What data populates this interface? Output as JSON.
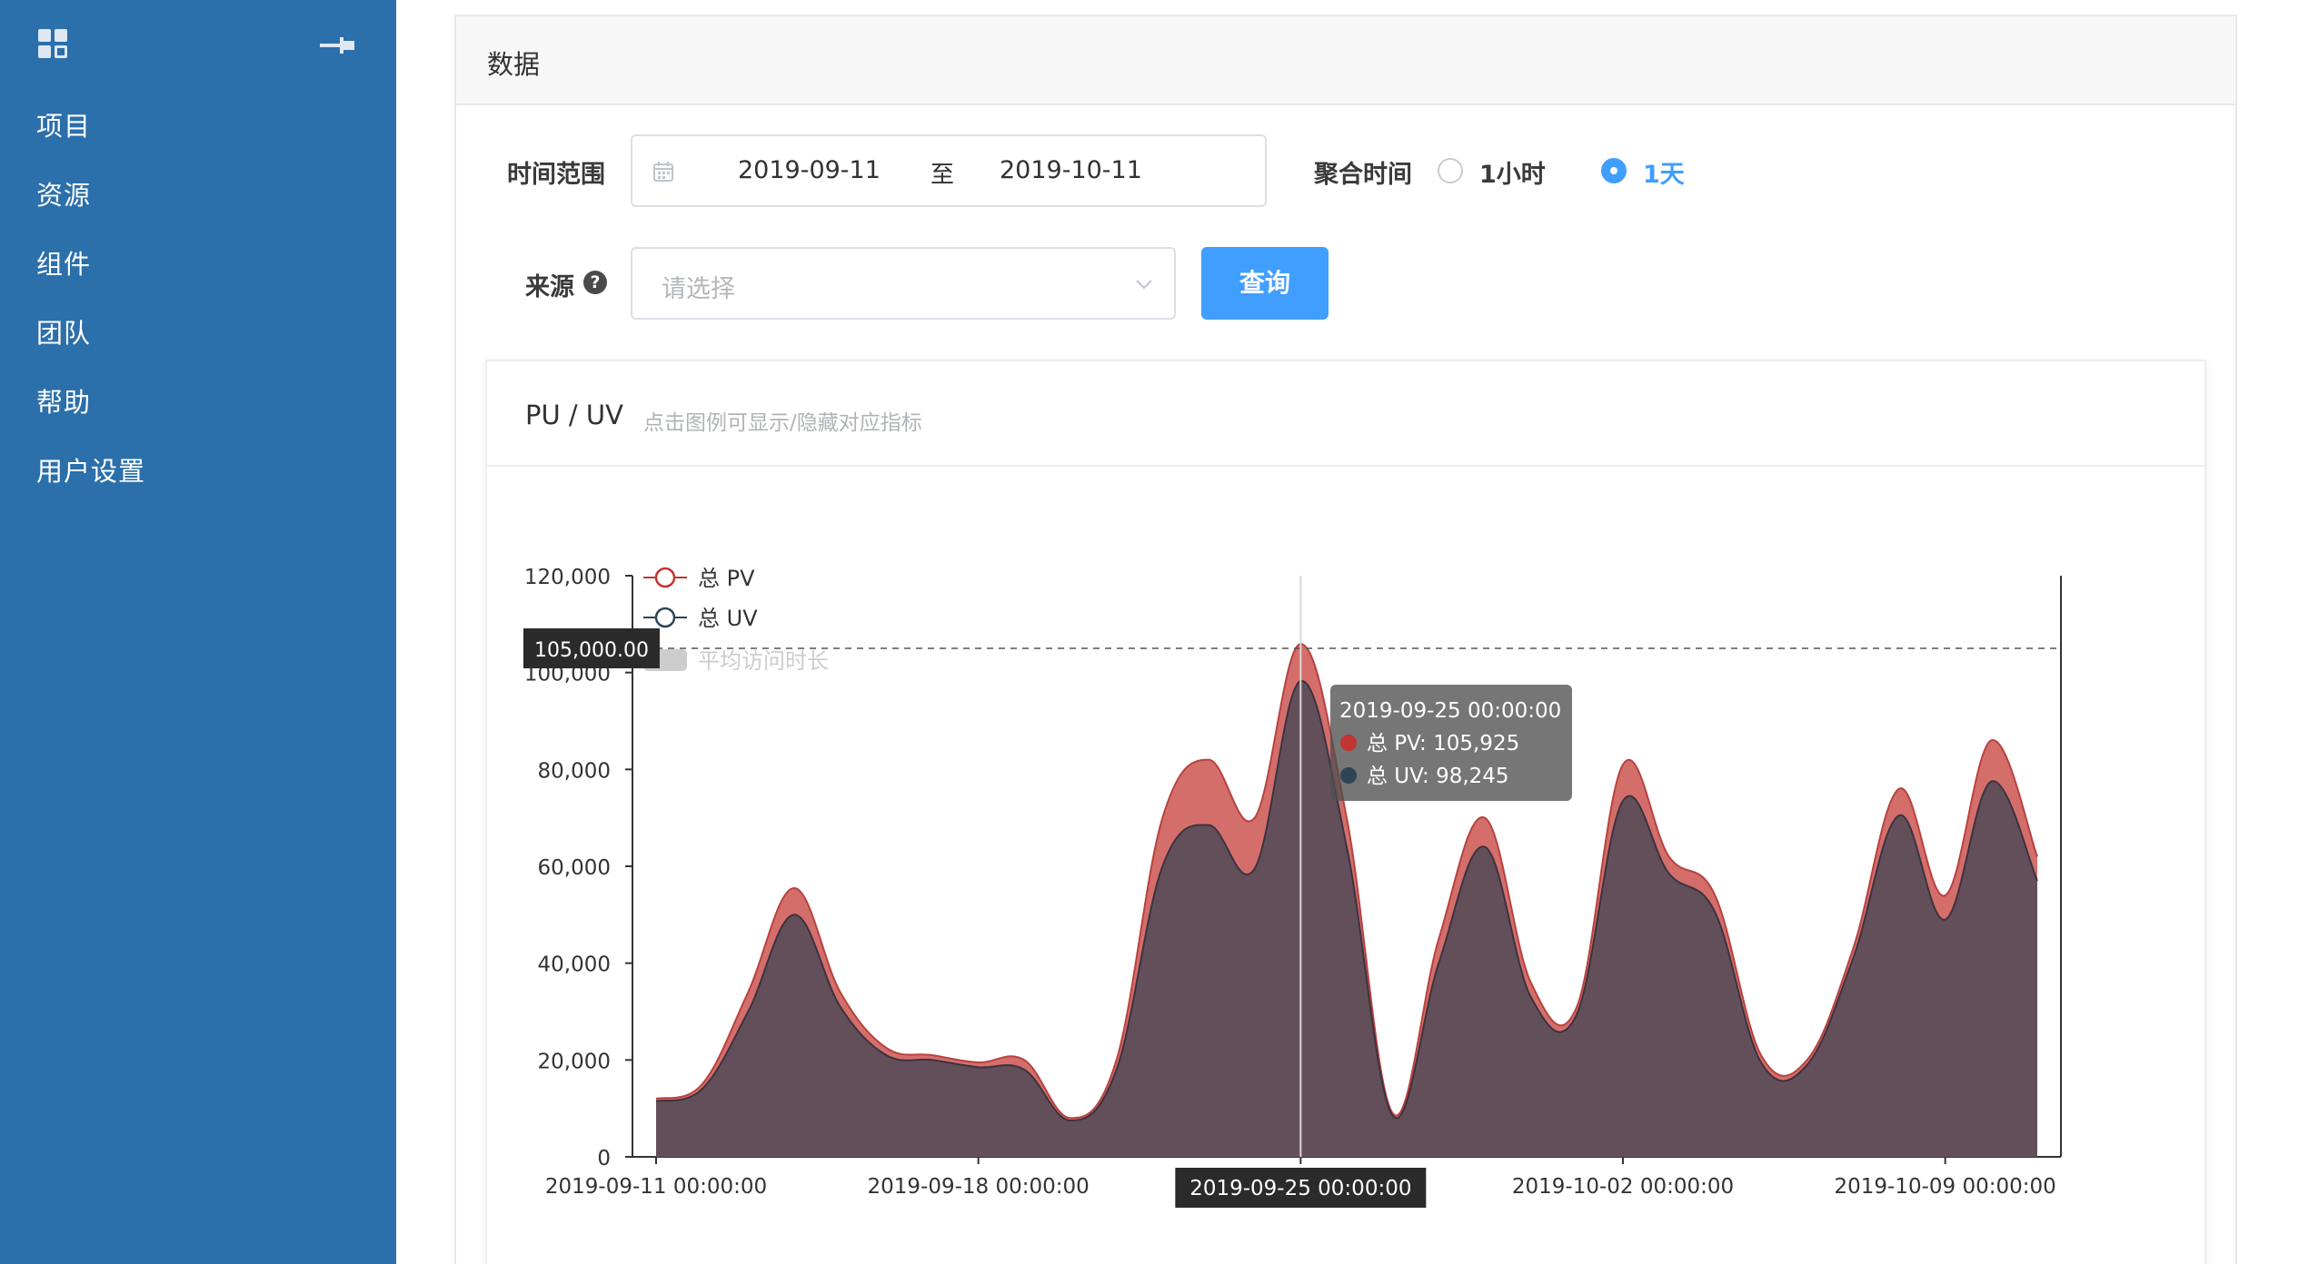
{
  "sidebar": {
    "items": [
      {
        "label": "项目"
      },
      {
        "label": "资源"
      },
      {
        "label": "组件"
      },
      {
        "label": "团队"
      },
      {
        "label": "帮助"
      },
      {
        "label": "用户设置"
      }
    ],
    "color": "#2b6fab"
  },
  "panel": {
    "title": "数据"
  },
  "filters": {
    "time_range_label": "时间范围",
    "date_start": "2019-09-11",
    "date_sep": "至",
    "date_end": "2019-10-11",
    "aggregate_label": "聚合时间",
    "aggregate_options": [
      {
        "label": "1小时",
        "selected": false
      },
      {
        "label": "1天",
        "selected": true
      }
    ],
    "source_label": "来源",
    "help_icon": "?",
    "source_placeholder": "请选择",
    "query_button": "查询",
    "accent": "#409eff"
  },
  "card": {
    "title": "PU / UV",
    "subtitle": "点击图例可显示/隐藏对应指标"
  },
  "chart_data": {
    "type": "area",
    "x_ticks": [
      "2019-09-11 00:00:00",
      "2019-09-18 00:00:00",
      "2019-09-25 00:00:00",
      "2019-10-02 00:00:00",
      "2019-10-09 00:00:00"
    ],
    "y_ticks": [
      "120,000",
      "100,000",
      "80,000",
      "60,000",
      "40,000",
      "20,000",
      "0"
    ],
    "ylim": [
      0,
      120000
    ],
    "legend": [
      {
        "label": "总 PV",
        "color": "#c23531"
      },
      {
        "label": "总 UV",
        "color": "#2f4554"
      },
      {
        "label": "平均访问时长",
        "color": "#cccccc"
      }
    ],
    "x": [
      "2019-09-11",
      "2019-09-12",
      "2019-09-13",
      "2019-09-14",
      "2019-09-15",
      "2019-09-16",
      "2019-09-17",
      "2019-09-18",
      "2019-09-19",
      "2019-09-20",
      "2019-09-21",
      "2019-09-22",
      "2019-09-23",
      "2019-09-24",
      "2019-09-25",
      "2019-09-26",
      "2019-09-27",
      "2019-09-28",
      "2019-09-29",
      "2019-09-30",
      "2019-10-01",
      "2019-10-02",
      "2019-10-03",
      "2019-10-04",
      "2019-10-05",
      "2019-10-06",
      "2019-10-07",
      "2019-10-08",
      "2019-10-09",
      "2019-10-10",
      "2019-10-11"
    ],
    "series": [
      {
        "name": "总 PV",
        "color": "#c23531",
        "values": [
          12000,
          15000,
          34000,
          55500,
          34000,
          22500,
          21000,
          19500,
          20000,
          8000,
          20000,
          70000,
          82000,
          70000,
          105925,
          70000,
          9000,
          45000,
          70000,
          36000,
          31000,
          81000,
          62000,
          54000,
          21000,
          20000,
          43000,
          76000,
          54000,
          86000,
          62000
        ]
      },
      {
        "name": "总 UV",
        "color": "#2f4554",
        "values": [
          11500,
          14000,
          30000,
          50000,
          31000,
          21000,
          20000,
          18500,
          18000,
          7500,
          18000,
          60000,
          68500,
          59500,
          98245,
          64000,
          8500,
          40000,
          64000,
          33000,
          29500,
          73500,
          58500,
          50500,
          19500,
          19000,
          41000,
          70500,
          49000,
          77500,
          57000
        ]
      }
    ],
    "tooltip": {
      "title": "2019-09-25 00:00:00",
      "lines": [
        "总 PV: 105,925",
        "总 UV: 98,245"
      ],
      "index": 14
    },
    "crosshair": {
      "x_label": "2019-09-25 00:00:00",
      "y_label": "105,000.00",
      "y_value": 105000
    }
  }
}
